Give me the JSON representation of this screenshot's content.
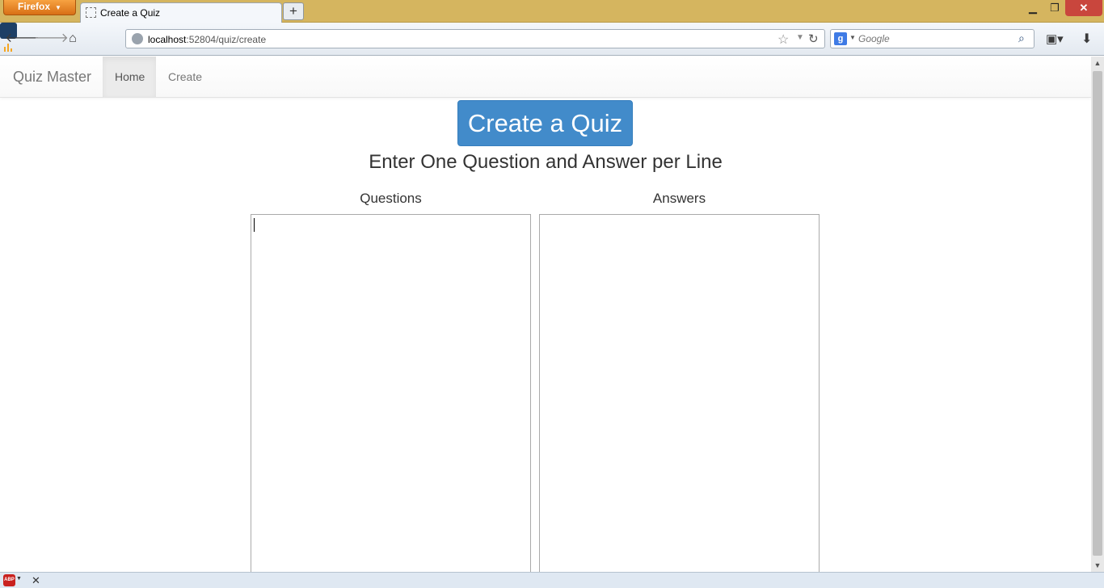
{
  "browser": {
    "menu_button": "Firefox",
    "tab_title": "Create a Quiz",
    "new_tab": "+",
    "url_host": "localhost",
    "url_rest": ":52804/quiz/create",
    "search_placeholder": "Google",
    "search_engine_letter": "g"
  },
  "site": {
    "brand": "Quiz Master",
    "nav": [
      {
        "label": "Home"
      },
      {
        "label": "Create"
      }
    ]
  },
  "page": {
    "create_button": "Create a Quiz",
    "instruction": "Enter One Question and Answer per Line",
    "questions_label": "Questions",
    "answers_label": "Answers",
    "questions_value": "",
    "answers_value": ""
  },
  "colors": {
    "titlebar": "#d5b55f",
    "firefox_button": "#e07a1f",
    "primary_button": "#428bca",
    "close_button": "#c9463d"
  },
  "icons": [
    "back-arrow-icon",
    "forward-arrow-icon",
    "home-icon",
    "chart-extension-icon",
    "globe-icon",
    "star-icon",
    "reload-icon",
    "search-icon",
    "bookmarks-icon",
    "download-icon",
    "adblock-icon",
    "close-icon"
  ]
}
